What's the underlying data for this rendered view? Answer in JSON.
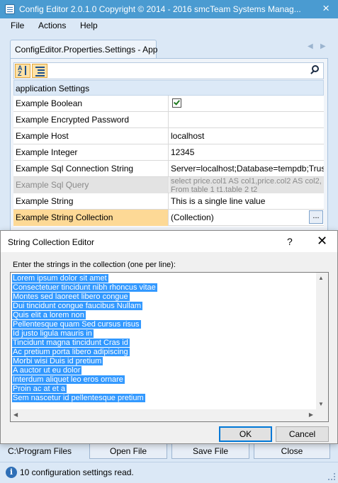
{
  "window": {
    "title": "Config Editor 2.0.1.0 Copyright © 2014 - 2016 smcTeam Systems Manag...",
    "close_glyph": "×"
  },
  "menu": [
    "File",
    "Actions",
    "Help"
  ],
  "tab": {
    "label": "ConfigEditor.Properties.Settings - App",
    "prev_arrow": "◀",
    "next_arrow": "▶"
  },
  "toolbar": {
    "sort_alpha_icon": "sort-alphabetical-icon",
    "sort_alpha_top": "A",
    "sort_alpha_bottom": "Z",
    "categorized_icon": "categorized-icon",
    "search_value": "",
    "search_icon": "search-icon"
  },
  "grid": {
    "category": "application Settings",
    "rows": [
      {
        "name": "Example Boolean",
        "value": "",
        "checked": true
      },
      {
        "name": "Example Encrypted Password",
        "value": ""
      },
      {
        "name": "Example Host",
        "value": "localhost"
      },
      {
        "name": "Example Integer",
        "value": "12345"
      },
      {
        "name": "Example Sql Connection String",
        "value": "Server=localhost;Database=tempdb;Truste"
      },
      {
        "name": "Example Sql Query",
        "value": "select price.col1 AS col1,price.col2 AS col2,",
        "value2": "From table  1 t1.table  2 t2",
        "disabled": true
      },
      {
        "name": "Example String",
        "value": "This is a single line value"
      },
      {
        "name": "Example String Collection",
        "value": "(Collection)",
        "button": "...",
        "selected": true
      }
    ]
  },
  "bottom": {
    "path": "C:\\Program Files",
    "open_button": "Open File",
    "save_button": "Save File",
    "close_button": "Close"
  },
  "status": {
    "icon": "info-icon",
    "text": "10 configuration settings read."
  },
  "dialog": {
    "title": "String Collection Editor",
    "help": "?",
    "close": "✕",
    "label": "Enter the strings in the collection (one per line):",
    "lines": [
      "Lorem ipsum dolor sit amet",
      "Consectetuer tincidunt nibh rhoncus vitae",
      "Montes sed laoreet libero congue",
      "Dui tincidunt congue faucibus Nullam",
      "Quis elit a lorem non",
      "Pellentesque quam Sed cursus risus",
      "Id justo ligula mauris in",
      "Tincidunt magna tincidunt Cras id",
      "Ac pretium porta libero adipiscing",
      "Morbi wisi Duis id pretium",
      "A auctor ut eu dolor",
      "Interdum aliquet leo eros ornare",
      "Proin ac at et a",
      "Sem nascetur id pellentesque pretium"
    ],
    "ok": "OK",
    "cancel": "Cancel"
  },
  "colors": {
    "titlebar": "#4a9bd1",
    "selection": "#3399ff",
    "selected_row": "#fdd996",
    "window_bg": "#dbe8f6"
  }
}
